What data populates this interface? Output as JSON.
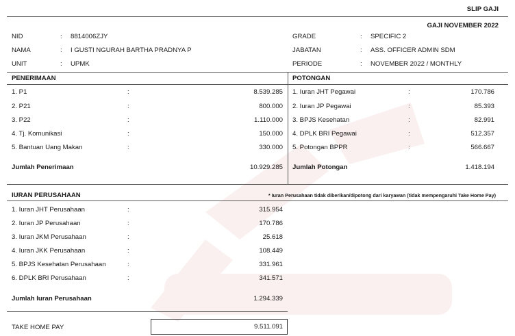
{
  "slip_title": "SLIP GAJI",
  "period_title": "GAJI NOVEMBER 2022",
  "employee": {
    "left": [
      {
        "label": "NID",
        "value": "8814006ZJY"
      },
      {
        "label": "NAMA",
        "value": "I GUSTI NGURAH BARTHA PRADNYA P"
      },
      {
        "label": "UNIT",
        "value": "UPMK"
      }
    ],
    "right": [
      {
        "label": "GRADE",
        "value": "SPECIFIC 2"
      },
      {
        "label": "JABATAN",
        "value": "ASS. OFFICER ADMIN SDM"
      },
      {
        "label": "PERIODE",
        "value": "NOVEMBER 2022 / MONTHLY"
      }
    ]
  },
  "separator": ":",
  "penerimaan": {
    "heading": "PENERIMAAN",
    "items": [
      {
        "label": "1. P1",
        "value": "8.539.285"
      },
      {
        "label": "2. P21",
        "value": "800.000"
      },
      {
        "label": "3. P22",
        "value": "1.110.000"
      },
      {
        "label": "4. Tj. Komunikasi",
        "value": "150.000"
      },
      {
        "label": "5. Bantuan Uang Makan",
        "value": "330.000"
      }
    ],
    "total_label": "Jumlah Penerimaan",
    "total_value": "10.929.285"
  },
  "potongan": {
    "heading": "POTONGAN",
    "items": [
      {
        "label": "1. Iuran JHT Pegawai",
        "value": "170.786"
      },
      {
        "label": "2. Iuran JP Pegawai",
        "value": "85.393"
      },
      {
        "label": "3. BPJS Kesehatan",
        "value": "82.991"
      },
      {
        "label": "4. DPLK BRI Pegawai",
        "value": "512.357"
      },
      {
        "label": "5. Potongan BPPR",
        "value": "566.667"
      }
    ],
    "total_label": "Jumlah Potongan",
    "total_value": "1.418.194"
  },
  "iuran": {
    "heading": "IURAN PERUSAHAAN",
    "note": "* Iuran Perusahaan tidak diberikan/dipotong dari karyawan (tidak mempengaruhi Take Home Pay)",
    "items": [
      {
        "label": "1. Iuran JHT Perusahaan",
        "value": "315.954"
      },
      {
        "label": "2. Iuran JP Perusahaan",
        "value": "170.786"
      },
      {
        "label": "3. Iuran JKM Perusahaan",
        "value": "25.618"
      },
      {
        "label": "4. Iuran JKK Perusahaan",
        "value": "108.449"
      },
      {
        "label": "5. BPJS Kesehatan Perusahaan",
        "value": "331.961"
      },
      {
        "label": "6. DPLK BRI Perusahaan",
        "value": "341.571"
      }
    ],
    "total_label": "Jumlah Iuran Perusahaan",
    "total_value": "1.294.339"
  },
  "take_home_pay": {
    "label": "TAKE HOME PAY",
    "value": "9.511.091"
  },
  "colors": {
    "line": "#555555",
    "text": "#1a1a1a",
    "watermark": "#c0392b"
  }
}
